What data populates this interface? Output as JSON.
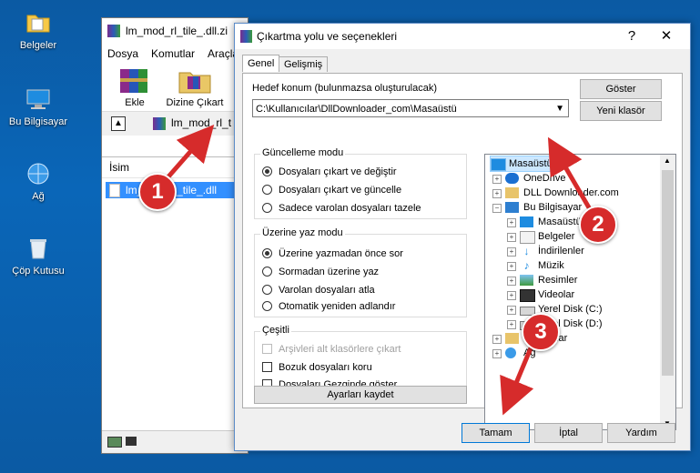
{
  "desktop": {
    "icons": [
      {
        "label": "Belgeler",
        "icon": "documents-folder-icon"
      },
      {
        "label": "Bu Bilgisayar",
        "icon": "computer-icon"
      },
      {
        "label": "Ağ",
        "icon": "network-icon"
      },
      {
        "label": "Çöp Kutusu",
        "icon": "recycle-bin-icon"
      }
    ]
  },
  "winrar": {
    "title": "lm_mod_rl_tile_.dll.zi",
    "menu": [
      "Dosya",
      "Komutlar",
      "Araçla"
    ],
    "toolbar": {
      "add": "Ekle",
      "extract_to": "Dizine Çıkart"
    },
    "path": "lm_mod_rl_t",
    "column_name": "İsim",
    "file": "lm_mod_rl_tile_.dll"
  },
  "dialog": {
    "title": "Çıkartma yolu ve seçenekleri",
    "help": "?",
    "close": "✕",
    "tabs": [
      "Genel",
      "Gelişmiş"
    ],
    "dest_label": "Hedef konum (bulunmazsa oluşturulacak)",
    "dest_value": "C:\\Kullanıcılar\\DllDownloader_com\\Masaüstü",
    "show_button": "Göster",
    "new_folder_button": "Yeni klasör",
    "update_mode": {
      "title": "Güncelleme modu",
      "options": [
        "Dosyaları çıkart ve değiştir",
        "Dosyaları çıkart ve güncelle",
        "Sadece varolan dosyaları tazele"
      ],
      "selected": 0
    },
    "overwrite_mode": {
      "title": "Üzerine yaz modu",
      "options": [
        "Üzerine yazmadan önce sor",
        "Sormadan üzerine yaz",
        "Varolan dosyaları atla",
        "Otomatik yeniden adlandır"
      ],
      "selected": 0
    },
    "misc": {
      "title": "Çeşitli",
      "options": [
        "Arşivleri alt klasörlere çıkart",
        "Bozuk dosyaları koru",
        "Dosyaları Gezginde göster"
      ]
    },
    "save_settings": "Ayarları kaydet",
    "tree": [
      {
        "label": "Masaüstü",
        "icon": "desktop-icon"
      },
      {
        "label": "OneDrive",
        "icon": "onedrive-icon"
      },
      {
        "label": "DLL Downloader.com",
        "icon": "user-icon"
      },
      {
        "label": "Bu Bilgisayar",
        "icon": "computer-icon"
      },
      {
        "label": "Masaüstü",
        "icon": "desktop-icon"
      },
      {
        "label": "Belgeler",
        "icon": "documents-icon"
      },
      {
        "label": "İndirilenler",
        "icon": "downloads-icon"
      },
      {
        "label": "Müzik",
        "icon": "music-icon"
      },
      {
        "label": "Resimler",
        "icon": "pictures-icon"
      },
      {
        "label": "Videolar",
        "icon": "videos-icon"
      },
      {
        "label": "Yerel Disk (C:)",
        "icon": "drive-icon"
      },
      {
        "label": "Yerel Disk (D:)",
        "icon": "drive-icon"
      },
      {
        "label": "Kitaplıklar",
        "icon": "libraries-icon"
      },
      {
        "label": "Ağ",
        "icon": "network-icon"
      }
    ],
    "ok": "Tamam",
    "cancel": "İptal",
    "help_button": "Yardım"
  },
  "annotations": [
    "1",
    "2",
    "3"
  ],
  "colors": {
    "badge": "#d62b2b",
    "selection": "#3390ff",
    "accent": "#0078d7"
  }
}
